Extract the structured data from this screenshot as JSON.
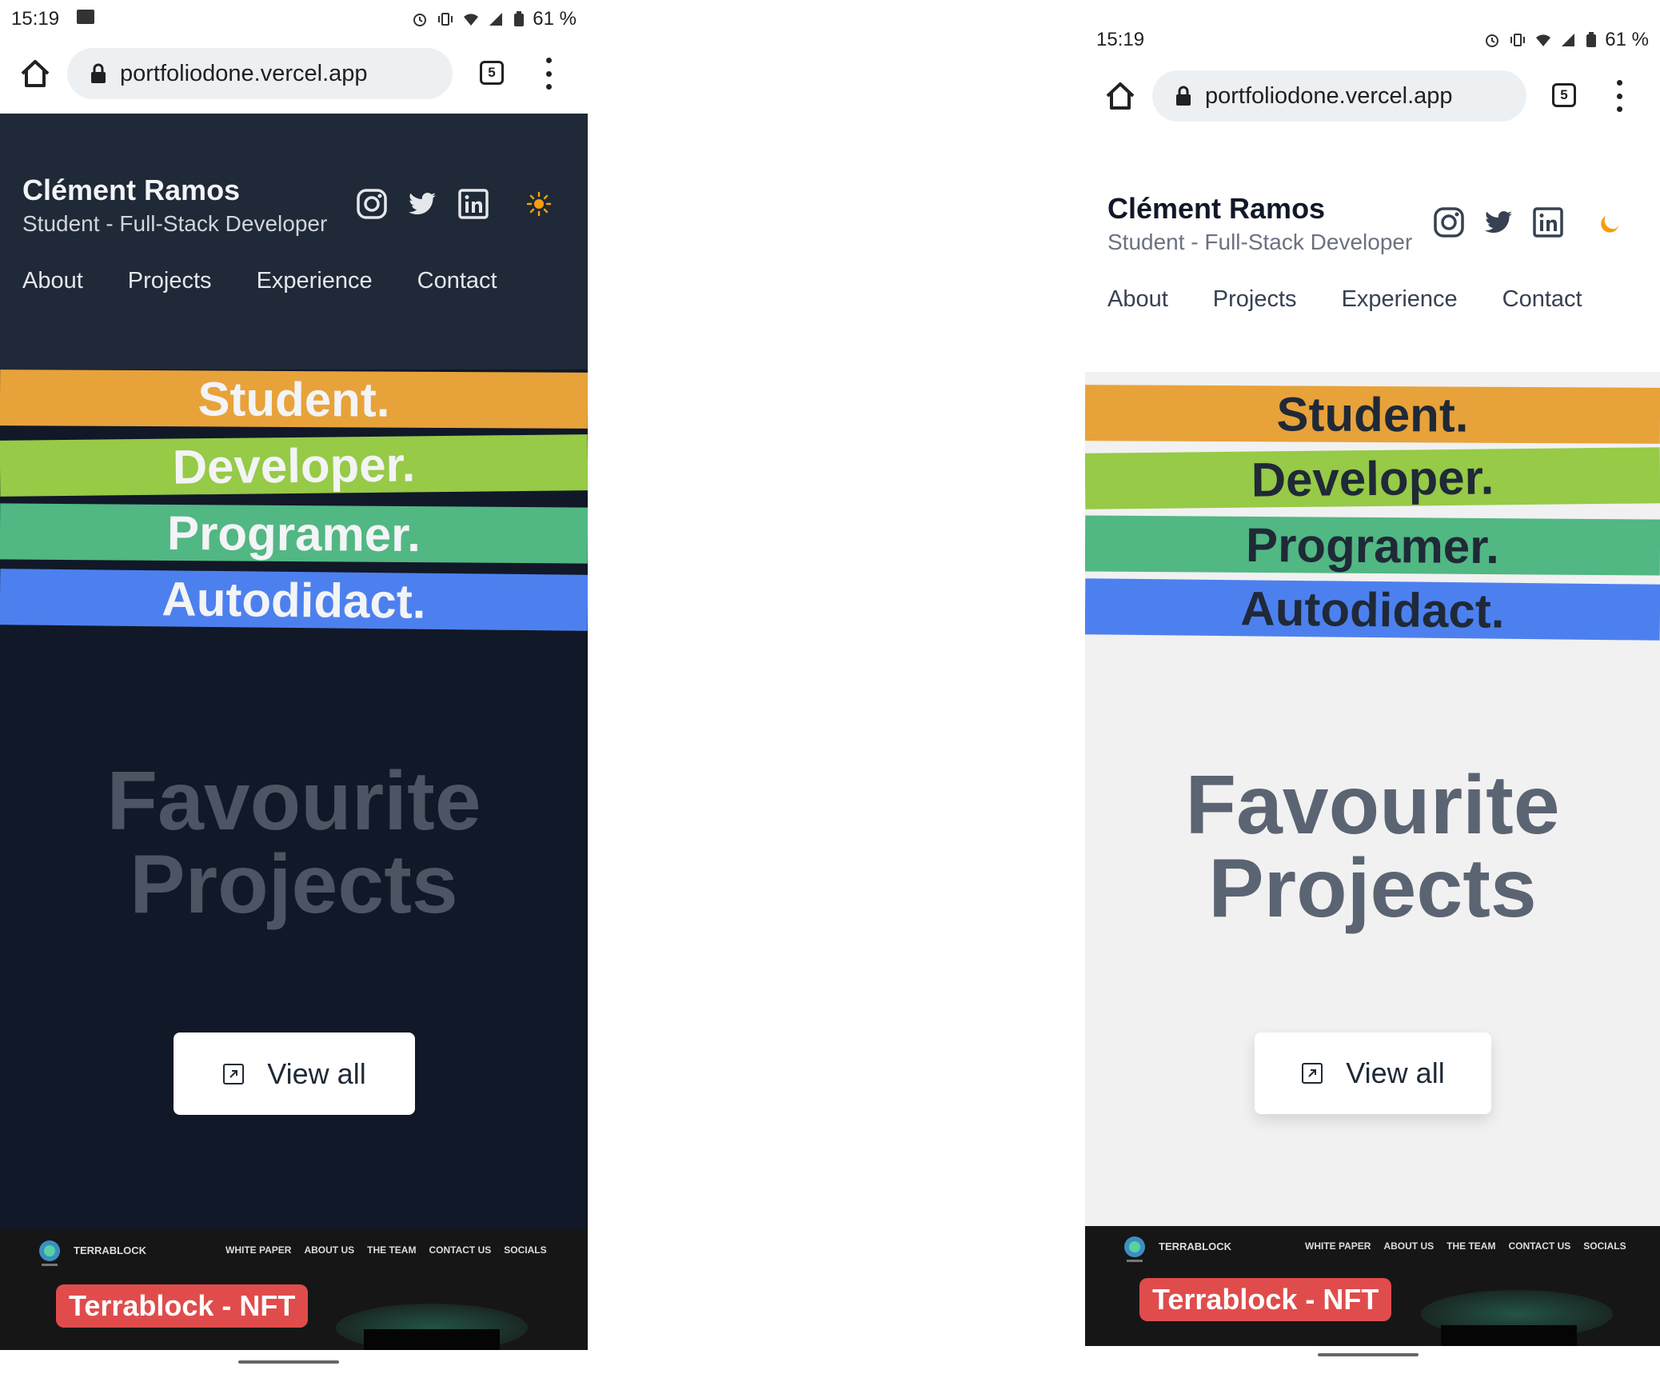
{
  "status": {
    "time": "15:19",
    "battery": "61 %"
  },
  "browser": {
    "url": "portfoliodone.vercel.app",
    "tab_count": "5"
  },
  "site": {
    "name": "Clément Ramos",
    "subtitle": "Student - Full-Stack Developer",
    "nav": [
      "About",
      "Projects",
      "Experience",
      "Contact"
    ],
    "bands": [
      "Student.",
      "Developer.",
      "Programer.",
      "Autodidact."
    ],
    "band_colors": [
      "#e8a23a",
      "#96ca47",
      "#51b783",
      "#4d80ef"
    ],
    "favourite_line1": "Favourite",
    "favourite_line2": "Projects",
    "view_all": "View all"
  },
  "project_preview": {
    "brand": "TERRABLOCK",
    "menu": [
      "WHITE PAPER",
      "ABOUT US",
      "THE TEAM",
      "CONTACT US",
      "SOCIALS"
    ],
    "badge": "Terrablock - NFT"
  },
  "icons": [
    "instagram-icon",
    "twitter-icon",
    "linkedin-icon",
    "sun-icon",
    "moon-icon",
    "home-icon",
    "lock-icon",
    "external-link-icon"
  ],
  "colors": {
    "accent": "#e8a23a",
    "dark_bg": "#111827",
    "light_bg": "#f1f1f1"
  }
}
